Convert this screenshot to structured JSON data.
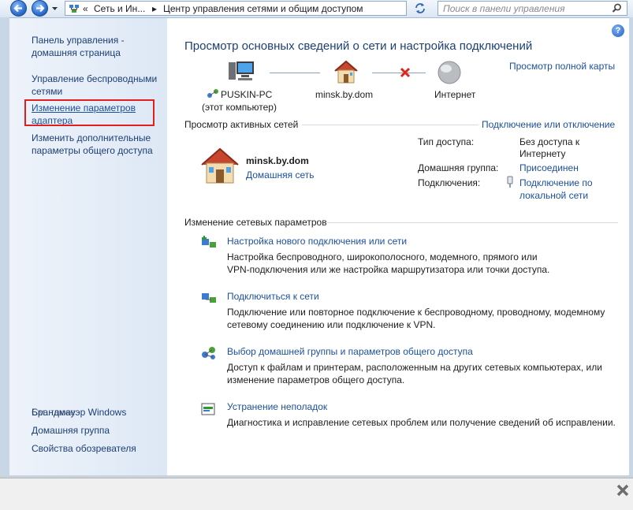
{
  "address": {
    "prefix": "«",
    "crumb1": "Сеть и Ин...",
    "crumb2": "Центр управления сетями и общим доступом",
    "search_placeholder": "Поиск в панели управления"
  },
  "sidebar": {
    "home": "Панель управления - домашняя страница",
    "wireless": "Управление беспроводными сетями",
    "adapter": "Изменение параметров адаптера",
    "sharing": "Изменить дополнительные параметры общего доступа",
    "see_also": "См. также",
    "firewall": "Брандмауэр Windows",
    "homegroup": "Домашняя группа",
    "browser": "Свойства обозревателя"
  },
  "main": {
    "help": "?",
    "title": "Просмотр основных сведений о сети и настройка подключений",
    "map_link": "Просмотр полной карты",
    "map": {
      "computer": "PUSKIN-PC",
      "computer_sub": "(этот компьютер)",
      "network": "minsk.by.dom",
      "internet": "Интернет"
    },
    "active": {
      "header": "Просмотр активных сетей",
      "connect_link": "Подключение или отключение",
      "name": "minsk.by.dom",
      "type": "Домашняя сеть",
      "access_label": "Тип доступа:",
      "access_value": "Без доступа к Интернету",
      "homegroup_label": "Домашняя группа:",
      "homegroup_value": "Присоединен",
      "conn_label": "Подключения:",
      "conn_value": "Подключение по локальной сети"
    },
    "change_header": "Изменение сетевых параметров",
    "tasks": [
      {
        "title": "Настройка нового подключения или сети",
        "desc1": "Настройка беспроводного, широкополосного, модемного, прямого или",
        "desc2": "VPN-подключения или же настройка маршрутизатора или точки доступа."
      },
      {
        "title": "Подключиться к сети",
        "desc1": "Подключение или повторное подключение к беспроводному, проводному, модемному",
        "desc2": "сетевому соединению или подключение к VPN."
      },
      {
        "title": "Выбор домашней группы и параметров общего доступа",
        "desc1": "Доступ к файлам и принтерам, расположенным на других сетевых компьютерах, или",
        "desc2": "изменение параметров общего доступа."
      },
      {
        "title": "Устранение неполадок",
        "desc1": "Диагностика и исправление сетевых проблем или получение сведений об исправлении.",
        "desc2": ""
      }
    ]
  }
}
